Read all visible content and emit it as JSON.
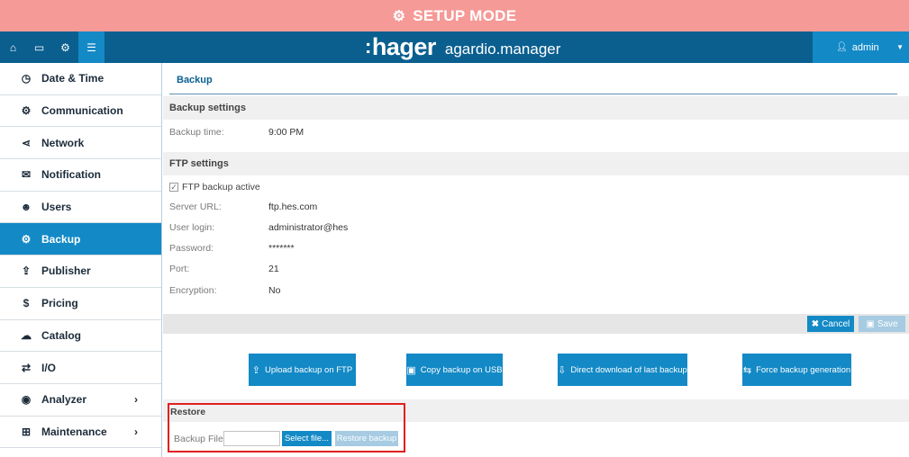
{
  "banner": {
    "icon": "gears-icon",
    "text": "SETUP MODE"
  },
  "topbar": {
    "nav": [
      {
        "name": "home-icon",
        "glyph": "⌂"
      },
      {
        "name": "laptop-icon",
        "glyph": "▭"
      },
      {
        "name": "gears-icon",
        "glyph": "⚙"
      },
      {
        "name": "sliders-icon",
        "glyph": "☰"
      }
    ],
    "brand_logo": "hager",
    "brand_product": "agardio.manager",
    "user": "admin"
  },
  "sidebar": {
    "items": [
      {
        "label": "Date & Time",
        "icon": "clock-icon",
        "glyph": "◷"
      },
      {
        "label": "Communication",
        "icon": "gears-icon",
        "glyph": "⚙"
      },
      {
        "label": "Network",
        "icon": "share-icon",
        "glyph": "⋖"
      },
      {
        "label": "Notification",
        "icon": "envelope-icon",
        "glyph": "✉"
      },
      {
        "label": "Users",
        "icon": "users-icon",
        "glyph": "☻"
      },
      {
        "label": "Backup",
        "icon": "gears-icon",
        "glyph": "⚙"
      },
      {
        "label": "Publisher",
        "icon": "upload-icon",
        "glyph": "⇪"
      },
      {
        "label": "Pricing",
        "icon": "dollar-icon",
        "glyph": "$"
      },
      {
        "label": "Catalog",
        "icon": "cloud-upload-icon",
        "glyph": "☁"
      },
      {
        "label": "I/O",
        "icon": "exchange-icon",
        "glyph": "⇄"
      },
      {
        "label": "Analyzer",
        "icon": "eye-icon",
        "glyph": "◉",
        "arrow": "›"
      },
      {
        "label": "Maintenance",
        "icon": "medkit-icon",
        "glyph": "⊞",
        "arrow": "›"
      }
    ]
  },
  "main": {
    "title": "Backup",
    "backup_settings": {
      "heading": "Backup settings",
      "time_label": "Backup time:",
      "time_value": "9:00 PM"
    },
    "ftp": {
      "heading": "FTP settings",
      "active_label": "FTP backup active",
      "active_checked": true,
      "server_label": "Server URL:",
      "server_value": "ftp.hes.com",
      "login_label": "User login:",
      "login_value": "administrator@hes",
      "password_label": "Password:",
      "password_value": "*******",
      "port_label": "Port:",
      "port_value": "21",
      "encryption_label": "Encryption:",
      "encryption_value": "No"
    },
    "actions": {
      "cancel": "Cancel",
      "save": "Save"
    },
    "buttons": {
      "upload_ftp": "Upload backup on FTP",
      "copy_usb": "Copy backup on USB",
      "direct_download": "Direct download of last backup",
      "force": "Force backup generation"
    },
    "restore": {
      "heading": "Restore",
      "file_label": "Backup File:",
      "file_value": "",
      "select_button": "Select file...",
      "restore_button": "Restore backup"
    }
  },
  "colors": {
    "banner": "#f59a97",
    "topbar": "#0a5f8f",
    "accent": "#1389c6",
    "highlight_box": "#e02020"
  }
}
